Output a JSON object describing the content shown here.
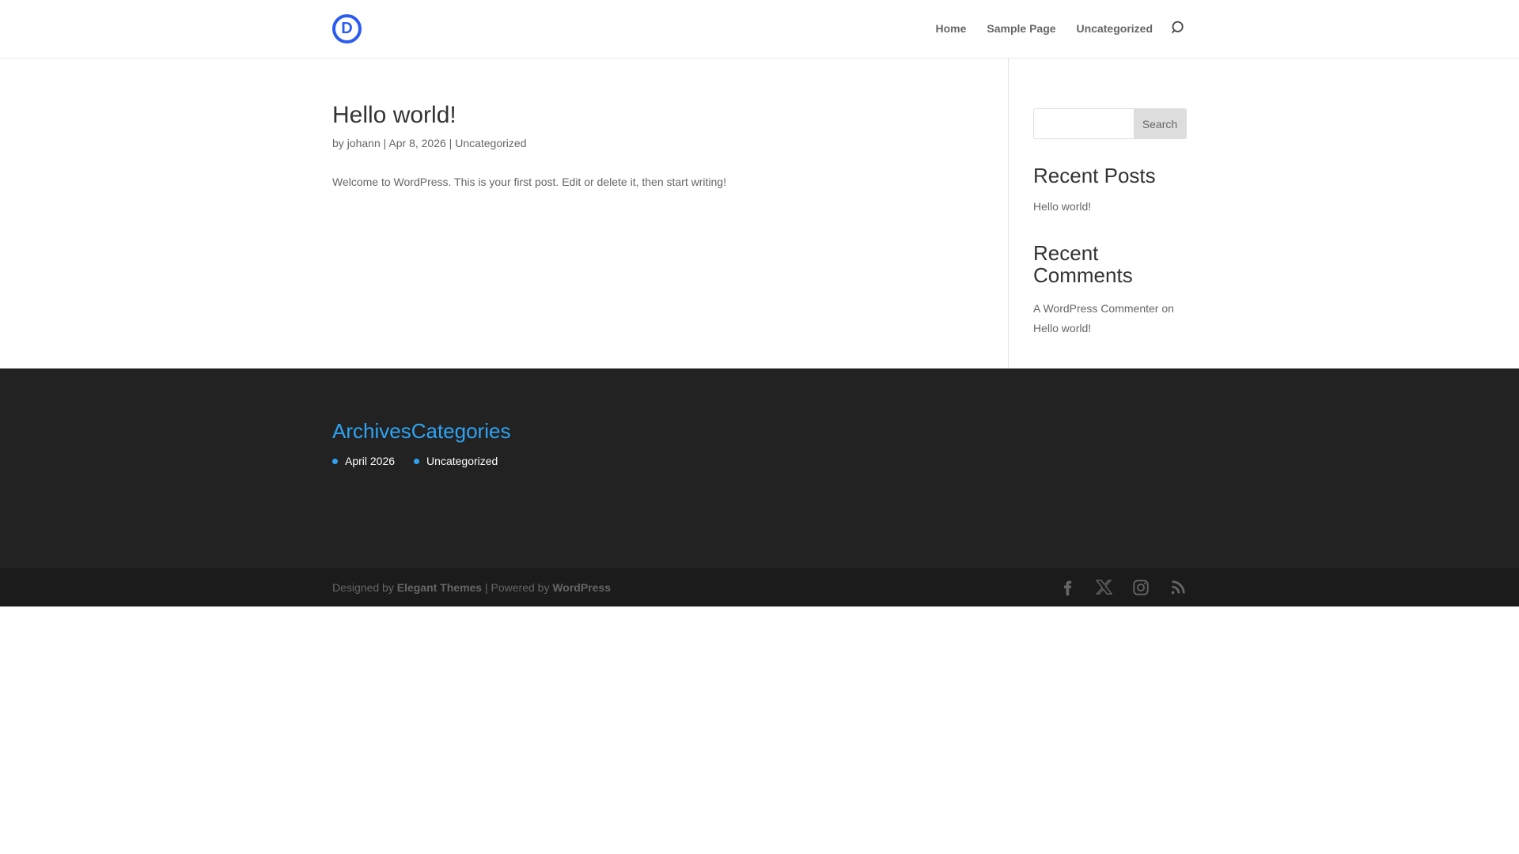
{
  "theme": {
    "logo_blue": "#2b5cf0",
    "accent_blue": "#2ea3f2",
    "heading_color": "#333333",
    "body_text_color": "#666666",
    "footer_bg": "#222222",
    "bottom_bar_bg": "#1b1b1b",
    "search_button_bg": "#dddddd"
  },
  "header": {
    "logo_letter": "D",
    "nav_items": [
      {
        "label": "Home"
      },
      {
        "label": "Sample Page"
      },
      {
        "label": "Uncategorized"
      }
    ],
    "icons": [
      "search-icon"
    ]
  },
  "post": {
    "title": "Hello world!",
    "meta": {
      "by": "by",
      "author": "johann",
      "sep": "|",
      "date": "Apr 8, 2026",
      "category": "Uncategorized"
    },
    "excerpt": "Welcome to WordPress. This is your first post. Edit or delete it, then start writing!"
  },
  "sidebar": {
    "search": {
      "button_label": "Search",
      "value": ""
    },
    "recent_posts": {
      "title": "Recent Posts",
      "items": [
        {
          "label": "Hello world!"
        }
      ]
    },
    "recent_comments": {
      "title": "Recent Comments",
      "items": [
        {
          "author": "A WordPress Commenter",
          "connector": "on",
          "post": "Hello world!"
        }
      ]
    }
  },
  "footer": {
    "widgets": [
      {
        "title": "Archives",
        "items": [
          {
            "label": "April 2026"
          }
        ]
      },
      {
        "title": "Categories",
        "items": [
          {
            "label": "Uncategorized"
          }
        ]
      }
    ],
    "credits": {
      "designed_by": "Designed by",
      "theme_author": "Elegant Themes",
      "powered_by": "| Powered by",
      "platform": "WordPress"
    },
    "social_icons": [
      "facebook",
      "x",
      "instagram",
      "rss"
    ]
  }
}
